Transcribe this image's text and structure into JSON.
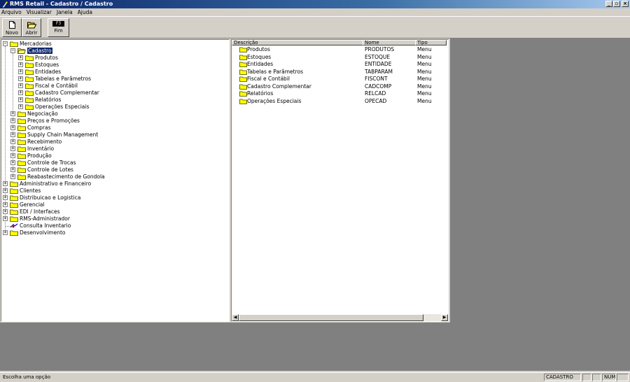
{
  "window": {
    "title": "RMS Retail - Cadastro / Cadastro"
  },
  "menu": [
    "Arquivo",
    "Visualizar",
    "Janela",
    "Ajuda"
  ],
  "toolbar": {
    "novo": "Novo",
    "abrir": "Abrir",
    "fim_key": "F3",
    "fim": "Fim"
  },
  "tree": [
    "Mercadorias",
    "Cadastro",
    "Produtos",
    "Estoques",
    "Entidades",
    "Tabelas e Parâmetros",
    "Fiscal e Contábil",
    "Cadastro Complementar",
    "Relatórios",
    "Operações Especiais",
    "Negociação",
    "Preços e Promoções",
    "Compras",
    "Supply Chain Management",
    "Recebimento",
    "Inventário",
    "Produção",
    "Controle de Trocas",
    "Controle de Lotes",
    "Reabastecimento de Gondola",
    "Administrativo e Financeiro",
    "Clientes",
    "Distribuicao e Logistica",
    "Gerencial",
    "EDI / Interfaces",
    "RMS-Administrador",
    "Consulta Inventario",
    "Desenvolvimento"
  ],
  "list": {
    "headers": [
      "Descrição",
      "Nome",
      "Tipo"
    ],
    "rows": [
      [
        "Produtos",
        "PRODUTOS",
        "Menu"
      ],
      [
        "Estoques",
        "ESTOQUE",
        "Menu"
      ],
      [
        "Entidades",
        "ENTIDADE",
        "Menu"
      ],
      [
        "Tabelas e Parâmetros",
        "TABPARAM",
        "Menu"
      ],
      [
        "Fiscal e Contábil",
        "FISCONT",
        "Menu"
      ],
      [
        "Cadastro Complementar",
        "CADCOMP",
        "Menu"
      ],
      [
        "Relatórios",
        "RELCAD",
        "Menu"
      ],
      [
        "Operações Especiais",
        "OPECAD",
        "Menu"
      ]
    ]
  },
  "status": {
    "message": "Escolha uma opção",
    "module": "CADASTRO",
    "num": "NUM"
  },
  "colors": {
    "title_start": "#0a246a",
    "title_end": "#a6caf0",
    "folder": "#ffff00",
    "selection": "#0a246a"
  },
  "icons": {
    "folder": "folder-icon",
    "open_folder": "open-folder-icon",
    "new": "new-document-icon",
    "open": "open-folder-icon",
    "exec": "executable-icon"
  }
}
